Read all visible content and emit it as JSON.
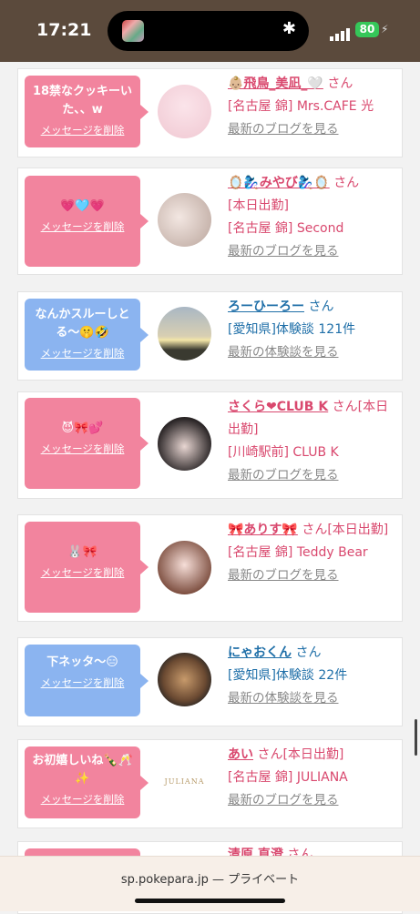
{
  "status_bar": {
    "time": "17:21",
    "battery": "80"
  },
  "cards": [
    {
      "bubble_text": "18禁なクッキーいた、、w",
      "bubble_color": "pink",
      "delete_label": "メッセージを削除",
      "name": "👶🏼飛鳥_美凪_🤍",
      "suffix": "さん",
      "line2": "[名古屋 錦] Mrs.CAFE 光",
      "line3": "",
      "link": "最新のブログを見る",
      "kind": "shop"
    },
    {
      "bubble_text": "💗🩵💗",
      "bubble_color": "pink",
      "delete_label": "メッセージを削除",
      "name": "🪞🧞‍♀️みやび🧞‍♀️🪞",
      "suffix": "さん",
      "line2": "[本日出勤]",
      "line3": "[名古屋 錦] Second",
      "link": "最新のブログを見る",
      "kind": "shop"
    },
    {
      "bubble_text": "なんかスルーしとる〜🤫🤣",
      "bubble_color": "blue",
      "delete_label": "メッセージを削除",
      "name": "ろーひーろー",
      "suffix": "さん",
      "line2": "[愛知県]体験談 121件",
      "line3": "",
      "link": "最新の体験談を見る",
      "kind": "user"
    },
    {
      "bubble_text": "😈🎀💕",
      "bubble_color": "pink",
      "delete_label": "メッセージを削除",
      "name": "さくら❤CLUB K",
      "suffix": "さん[本日出勤]",
      "line2": "[川崎駅前] CLUB K",
      "line3": "",
      "link": "最新のブログを見る",
      "kind": "shop"
    },
    {
      "bubble_text": "🐰🎀",
      "bubble_color": "pink",
      "delete_label": "メッセージを削除",
      "name": "🎀ありす🎀",
      "suffix": "さん[本日出勤]",
      "line2": "[名古屋 錦] Teddy Bear",
      "line3": "",
      "link": "最新のブログを見る",
      "kind": "shop"
    },
    {
      "bubble_text": "下ネッタ〜😑",
      "bubble_color": "blue",
      "delete_label": "メッセージを削除",
      "name": "にゃおくん",
      "suffix": "さん",
      "line2": "[愛知県]体験談 22件",
      "line3": "",
      "link": "最新の体験談を見る",
      "kind": "user"
    },
    {
      "bubble_text": "お初嬉しいね🍾🥂✨",
      "bubble_color": "pink",
      "delete_label": "メッセージを削除",
      "name": "あい",
      "suffix": "さん[本日出勤]",
      "line2": "[名古屋 錦] JULIANA",
      "line3": "",
      "link": "最新のブログを見る",
      "kind": "shop",
      "avatar_logo": "JULIANA"
    },
    {
      "bubble_text": "",
      "bubble_color": "pink",
      "delete_label": "",
      "name": "清原 直澄",
      "suffix": "さん",
      "line2": "",
      "line3": "",
      "link": "",
      "kind": "shop"
    }
  ],
  "bottom_bar": {
    "url": "sp.pokepara.jp — プライベート"
  }
}
